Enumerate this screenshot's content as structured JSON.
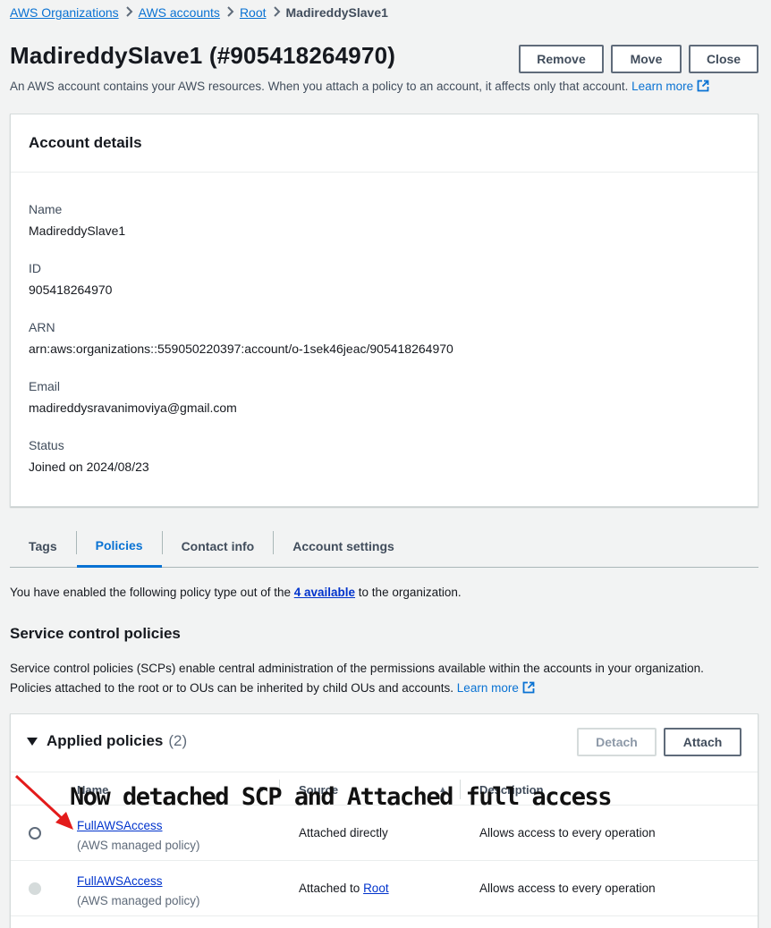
{
  "breadcrumb": {
    "items": [
      "AWS Organizations",
      "AWS accounts",
      "Root"
    ],
    "current": "MadireddySlave1"
  },
  "header": {
    "title": "MadireddySlave1 (#905418264970)",
    "description": "An AWS account contains your AWS resources. When you attach a policy to an account, it affects only that account.",
    "learn_more": "Learn more",
    "buttons": {
      "remove": "Remove",
      "move": "Move",
      "close": "Close"
    }
  },
  "account_details": {
    "title": "Account details",
    "fields": [
      {
        "label": "Name",
        "value": "MadireddySlave1"
      },
      {
        "label": "ID",
        "value": "905418264970"
      },
      {
        "label": "ARN",
        "value": "arn:aws:organizations::559050220397:account/o-1sek46jeac/905418264970"
      },
      {
        "label": "Email",
        "value": "madireddysravanimoviya@gmail.com"
      },
      {
        "label": "Status",
        "value": "Joined on 2024/08/23"
      }
    ]
  },
  "tabs": [
    {
      "label": "Tags",
      "active": false
    },
    {
      "label": "Policies",
      "active": true
    },
    {
      "label": "Contact info",
      "active": false
    },
    {
      "label": "Account settings",
      "active": false
    }
  ],
  "policy_note": {
    "before": "You have enabled the following policy type out of the ",
    "link": "4 available",
    "after": " to the organization."
  },
  "scp": {
    "title": "Service control policies",
    "description_line1": "Service control policies (SCPs) enable central administration of the permissions available within the accounts in your organization.",
    "description_line2": "Policies attached to the root or to OUs can be inherited by child OUs and accounts.",
    "learn_more": "Learn more"
  },
  "applied_policies": {
    "title": "Applied policies",
    "count": "(2)",
    "buttons": {
      "detach": "Detach",
      "attach": "Attach"
    },
    "columns": {
      "name": "Name",
      "source": "Source",
      "description": "Description"
    },
    "rows": [
      {
        "name": "FullAWSAccess",
        "type": "(AWS managed policy)",
        "source": "Attached directly",
        "source_link": "",
        "description": "Allows access to every operation"
      },
      {
        "name": "FullAWSAccess",
        "type": "(AWS managed policy)",
        "source": "Attached to ",
        "source_link": "Root",
        "description": "Allows access to every operation"
      }
    ]
  },
  "annotation": {
    "text": "Now detached SCP and Attached full access",
    "arrow_color": "#e31b1b"
  },
  "colors": {
    "link": "#0972d3",
    "background": "#f2f3f3",
    "panel": "#ffffff"
  }
}
